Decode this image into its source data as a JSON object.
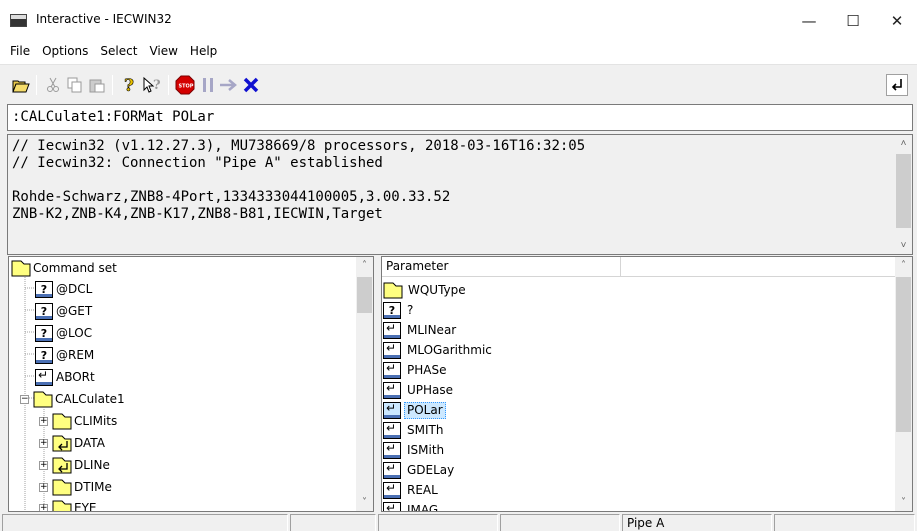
{
  "window": {
    "title": "Interactive - IECWIN32",
    "controls": {
      "minimize": "—",
      "maximize": "☐",
      "close": "✕"
    }
  },
  "menu": [
    "File",
    "Options",
    "Select",
    "View",
    "Help"
  ],
  "toolbar": {
    "buttons": [
      "open-icon",
      "cut-icon",
      "copy-icon",
      "paste-icon",
      "help-icon",
      "context-help-icon",
      "stop-icon",
      "pause-icon",
      "step-icon",
      "clear-icon"
    ],
    "right_button": "return-icon"
  },
  "command_input": ":CALCulate1:FORMat POLar",
  "output": {
    "lines": [
      "// Iecwin32 (v1.12.27.3), MU738669/8 processors, 2018-03-16T16:32:05",
      "// Iecwin32: Connection \"Pipe A\" established",
      "",
      "Rohde-Schwarz,ZNB8-4Port,1334333044100005,3.00.33.52",
      "ZNB-K2,ZNB-K4,ZNB-K17,ZNB8-B81,IECWIN,Target"
    ]
  },
  "tree": {
    "root": "Command set",
    "items": [
      {
        "label": "@DCL",
        "type": "query"
      },
      {
        "label": "@GET",
        "type": "query"
      },
      {
        "label": "@LOC",
        "type": "query"
      },
      {
        "label": "@REM",
        "type": "query"
      },
      {
        "label": "ABORt",
        "type": "enter"
      },
      {
        "label": "CALCulate1",
        "type": "folder"
      },
      {
        "label": "CLIMits",
        "type": "folder"
      },
      {
        "label": "DATA",
        "type": "folder-enter"
      },
      {
        "label": "DLINe",
        "type": "folder-enter"
      },
      {
        "label": "DTIMe",
        "type": "folder"
      },
      {
        "label": "EYE",
        "type": "folder"
      }
    ]
  },
  "parameters": {
    "headers": [
      "Parameter",
      ""
    ],
    "items": [
      {
        "label": "WQUType",
        "type": "folder"
      },
      {
        "label": "?",
        "type": "query"
      },
      {
        "label": "MLINear",
        "type": "enter"
      },
      {
        "label": "MLOGarithmic",
        "type": "enter"
      },
      {
        "label": "PHASe",
        "type": "enter"
      },
      {
        "label": "UPHase",
        "type": "enter"
      },
      {
        "label": "POLar",
        "type": "enter",
        "selected": true
      },
      {
        "label": "SMITh",
        "type": "enter"
      },
      {
        "label": "ISMith",
        "type": "enter"
      },
      {
        "label": "GDELay",
        "type": "enter"
      },
      {
        "label": "REAL",
        "type": "enter"
      },
      {
        "label": "IMAG",
        "type": "enter"
      }
    ]
  },
  "status": [
    "",
    "",
    "",
    "",
    "Pipe A",
    ""
  ]
}
